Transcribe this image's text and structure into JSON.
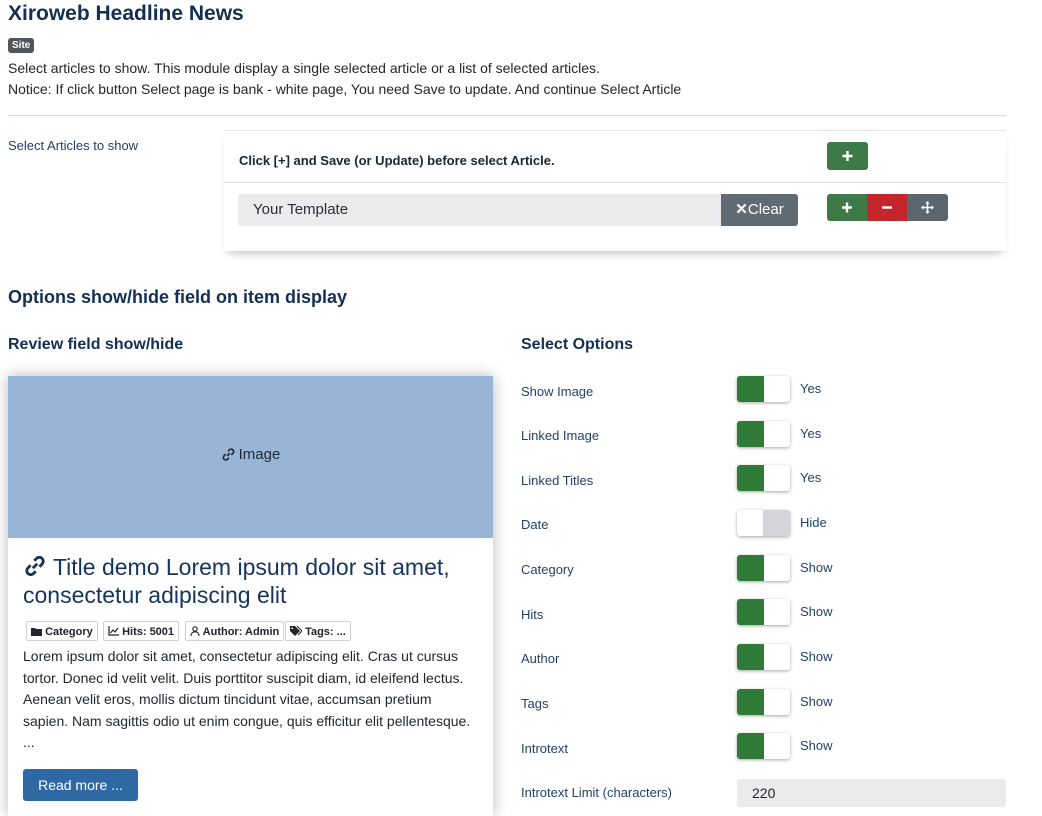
{
  "header": {
    "title": "Xiroweb Headline News",
    "badge": "Site",
    "desc1": "Select articles to show. This module display a single selected article or a list of selected articles.",
    "desc2": "Notice: If click button Select page is bank - white page, You need Save to update. And continue Select Article"
  },
  "articles": {
    "label": "Select Articles to show",
    "note": "Click [+] and Save (or Update) before select Article.",
    "template_value": "Your Template",
    "clear_label": "Clear"
  },
  "options": {
    "heading": "Options show/hide field on item display",
    "review_heading": "Review field show/hide",
    "select_heading": "Select Options",
    "items": [
      {
        "label": "Show Image",
        "state": "Yes",
        "on": true
      },
      {
        "label": "Linked Image",
        "state": "Yes",
        "on": true
      },
      {
        "label": "Linked Titles",
        "state": "Yes",
        "on": true
      },
      {
        "label": "Date",
        "state": "Hide",
        "on": false
      },
      {
        "label": "Category",
        "state": "Show",
        "on": true
      },
      {
        "label": "Hits",
        "state": "Show",
        "on": true
      },
      {
        "label": "Author",
        "state": "Show",
        "on": true
      },
      {
        "label": "Tags",
        "state": "Show",
        "on": true
      },
      {
        "label": "Introtext",
        "state": "Show",
        "on": true
      }
    ],
    "limit_label": "Introtext Limit (characters)",
    "limit_value": "220"
  },
  "preview": {
    "image_label": "Image",
    "title": "Title demo Lorem ipsum dolor sit amet, consectetur adipiscing elit",
    "tags": {
      "category": "Category",
      "hits": "Hits: 5001",
      "author": "Author: Admin",
      "tags": "Tags: ..."
    },
    "text": "Lorem ipsum dolor sit amet, consectetur adipiscing elit. Cras ut cursus tortor. Donec id velit velit. Duis porttitor suscipit diam, id eleifend lectus. Aenean velit eros, mollis dictum tincidunt vitae, accumsan pretium sapien. Nam sagittis odio ut enim congue, quis efficitur elit pellentesque. ...",
    "read_more": "Read more ..."
  },
  "colors": {
    "heading": "#132f53",
    "switch_on": "#2f7a36",
    "btn_green": "#3d7a48",
    "btn_red": "#c3272c",
    "read_more": "#2f69a4",
    "image_placeholder": "#98b4d6"
  }
}
